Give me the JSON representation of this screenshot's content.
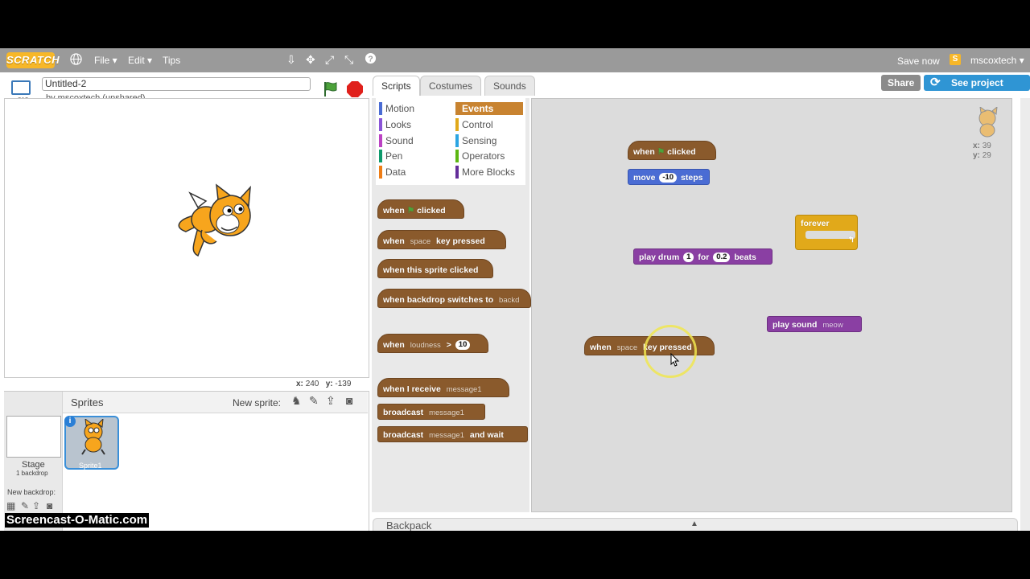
{
  "menubar": {
    "logo": "SCRATCH",
    "file": "File",
    "edit": "Edit",
    "tips": "Tips",
    "save_now": "Save now",
    "username": "mscoxtech"
  },
  "project": {
    "title": "Untitled-2",
    "author": "by mscoxtech (unshared)",
    "version": "v313",
    "share": "Share",
    "see_project_page": "See project page"
  },
  "stage": {
    "coords_x_label": "x:",
    "coords_x": "240",
    "coords_y_label": "y:",
    "coords_y": "-139"
  },
  "tabs": [
    "Scripts",
    "Costumes",
    "Sounds"
  ],
  "categories_left": [
    {
      "label": "Motion",
      "color": "#4a6cd4"
    },
    {
      "label": "Looks",
      "color": "#8a55d7"
    },
    {
      "label": "Sound",
      "color": "#bb42c3"
    },
    {
      "label": "Pen",
      "color": "#0e9a6c"
    },
    {
      "label": "Data",
      "color": "#ee7d16"
    }
  ],
  "categories_right": [
    {
      "label": "Events",
      "color": "#c88330"
    },
    {
      "label": "Control",
      "color": "#e1a91a"
    },
    {
      "label": "Sensing",
      "color": "#2ca5e2"
    },
    {
      "label": "Operators",
      "color": "#5cb712"
    },
    {
      "label": "More Blocks",
      "color": "#632d99"
    }
  ],
  "palette_blocks": {
    "when_flag_when": "when",
    "when_flag_clicked": "clicked",
    "when_key_when": "when",
    "when_key_key": "space",
    "when_key_pressed": "key pressed",
    "sprite_clicked": "when this sprite clicked",
    "backdrop_switches": "when backdrop switches to",
    "backdrop_value": "backd",
    "loudness_when": "when",
    "loudness_sensor": "loudness",
    "loudness_op": ">",
    "loudness_value": "10",
    "receive_when": "when I receive",
    "receive_msg": "message1",
    "broadcast": "broadcast",
    "broadcast_msg": "message1",
    "broadcast_wait": "broadcast",
    "broadcast_wait_msg": "message1",
    "broadcast_wait_suffix": "and wait"
  },
  "script_blocks": {
    "flag_hat_when": "when",
    "flag_hat_clicked": "clicked",
    "move_label": "move",
    "move_value": "-10",
    "move_steps": "steps",
    "forever_label": "forever",
    "drum_play": "play drum",
    "drum_value": "1",
    "drum_for": "for",
    "drum_beats_value": "0.2",
    "drum_beats": "beats",
    "sound_play": "play sound",
    "sound_value": "meow",
    "key_hat_when": "when",
    "key_hat_key": "space",
    "key_hat_pressed": "key pressed"
  },
  "sprite_info": {
    "x_label": "x:",
    "x": "39",
    "y_label": "y:",
    "y": "29"
  },
  "sprites_panel": {
    "title": "Sprites",
    "new_sprite": "New sprite:",
    "stage_label": "Stage",
    "stage_backdrops": "1 backdrop",
    "new_backdrop": "New backdrop:",
    "sprite_name": "Sprite1"
  },
  "backpack": "Backpack",
  "watermark": "Screencast-O-Matic.com"
}
